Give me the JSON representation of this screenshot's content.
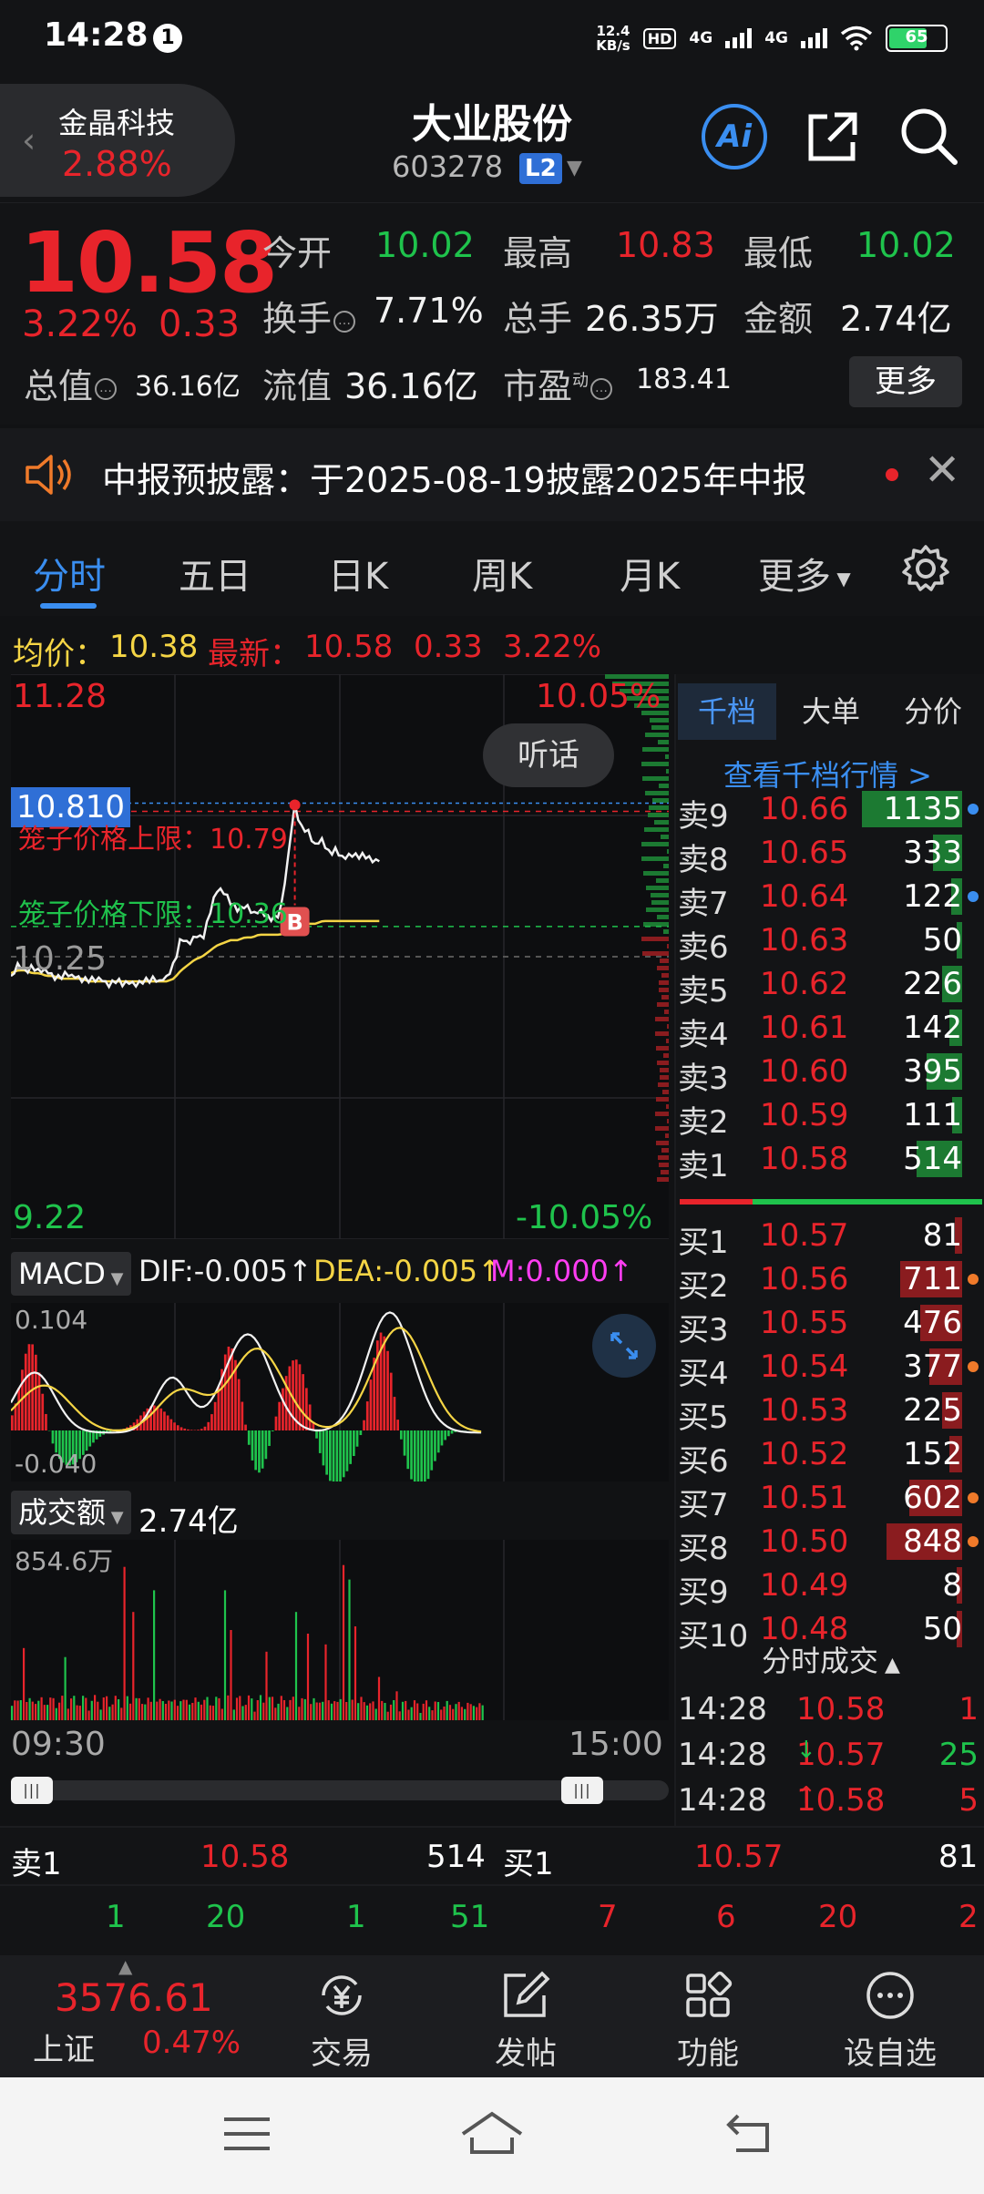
{
  "status_bar": {
    "time": "14:28",
    "notification_count": "1",
    "net_speed_value": "12.4",
    "net_speed_unit": "KB/s",
    "hd": "HD",
    "hd_sub": "1",
    "sig1": "4G",
    "sig2": "4G",
    "battery": "65"
  },
  "header": {
    "back_name": "金晶科技",
    "back_pct": "2.88%",
    "stock_name": "大业股份",
    "stock_code": "603278",
    "level": "L2",
    "ai": "Ai"
  },
  "quote": {
    "price": "10.58",
    "change_pct": "3.22%",
    "change": "0.33",
    "open_label": "今开",
    "open": "10.02",
    "high_label": "最高",
    "high": "10.83",
    "low_label": "最低",
    "low": "10.02",
    "turnover_label": "换手",
    "turnover": "7.71%",
    "volume_label": "总手",
    "volume": "26.35万",
    "amount_label": "金额",
    "amount": "2.74亿",
    "mktcap_label": "总值",
    "mktcap": "36.16亿",
    "float_label": "流值",
    "float": "36.16亿",
    "pe_label": "市盈",
    "pe_sup": "动",
    "pe": "183.41",
    "more": "更多"
  },
  "notice": {
    "text": "中报预披露：于2025-08-19披露2025年中报"
  },
  "tabs": [
    {
      "label": "分时"
    },
    {
      "label": "五日"
    },
    {
      "label": "日K"
    },
    {
      "label": "周K"
    },
    {
      "label": "月K"
    },
    {
      "label": "更多"
    }
  ],
  "avg_line": {
    "avg_label": "均价：",
    "avg": "10.38",
    "last_label": "最新：",
    "last": "10.58",
    "chg": "0.33",
    "pct": "3.22%"
  },
  "chart": {
    "top_price": "11.28",
    "top_pct": "10.05%",
    "mid_price": "10.25",
    "bottom_price": "9.22",
    "bottom_pct": "-10.05%",
    "listen": "听话",
    "flag_price": "10.810",
    "cage_high": "笼子价格上限：10.79",
    "cage_low": "笼子价格下限：10.36",
    "buy_marker": "B"
  },
  "chart_data": {
    "type": "line",
    "title": "",
    "ylim": [
      9.22,
      11.28
    ],
    "x_range": [
      "09:30",
      "15:00"
    ],
    "reference_price": 10.25,
    "price": [
      10.18,
      10.22,
      10.2,
      10.21,
      10.19,
      10.2,
      10.18,
      10.17,
      10.19,
      10.18,
      10.17,
      10.16,
      10.17,
      10.16,
      10.15,
      10.16,
      10.15,
      10.16,
      10.15,
      10.16,
      10.17,
      10.16,
      10.17,
      10.22,
      10.32,
      10.3,
      10.33,
      10.31,
      10.4,
      10.5,
      10.48,
      10.45,
      10.42,
      10.44,
      10.41,
      10.42,
      10.4,
      10.39,
      10.4,
      10.58,
      10.81,
      10.72,
      10.7,
      10.66,
      10.68,
      10.62,
      10.64,
      10.6,
      10.63,
      10.61,
      10.62,
      10.6,
      10.61
    ],
    "avg": [
      10.19,
      10.2,
      10.2,
      10.19,
      10.19,
      10.18,
      10.18,
      10.17,
      10.17,
      10.17,
      10.17,
      10.16,
      10.16,
      10.16,
      10.16,
      10.16,
      10.16,
      10.16,
      10.16,
      10.16,
      10.16,
      10.16,
      10.16,
      10.17,
      10.2,
      10.22,
      10.24,
      10.25,
      10.27,
      10.29,
      10.3,
      10.31,
      10.31,
      10.32,
      10.32,
      10.33,
      10.33,
      10.33,
      10.33,
      10.34,
      10.36,
      10.37,
      10.37,
      10.37,
      10.38,
      10.38,
      10.38,
      10.38,
      10.38,
      10.38,
      10.38,
      10.38,
      10.38
    ],
    "macd": {
      "label": "MACD",
      "dif_label": "DIF:",
      "dif": "-0.005",
      "dea_label": "DEA:",
      "dea": "-0.005",
      "m_label": "M:",
      "m": "0.000",
      "top": "0.104",
      "bottom": "-0.040"
    },
    "volume": {
      "label": "成交额",
      "total": "2.74亿",
      "max": "854.6万"
    },
    "time_start": "09:30",
    "time_end": "15:00"
  },
  "order_book": {
    "tabs": [
      "千档",
      "大单",
      "分价"
    ],
    "more_link": "查看千档行情 >",
    "asks": [
      {
        "label": "卖9",
        "price": "10.66",
        "qty": "1135",
        "bar": 1.0,
        "dot": "#3a8ef0"
      },
      {
        "label": "卖8",
        "price": "10.65",
        "qty": "333",
        "bar": 0.29,
        "dot": ""
      },
      {
        "label": "卖7",
        "price": "10.64",
        "qty": "122",
        "bar": 0.11,
        "dot": "#3a8ef0"
      },
      {
        "label": "卖6",
        "price": "10.63",
        "qty": "50",
        "bar": 0.04,
        "dot": ""
      },
      {
        "label": "卖5",
        "price": "10.62",
        "qty": "226",
        "bar": 0.2,
        "dot": ""
      },
      {
        "label": "卖4",
        "price": "10.61",
        "qty": "142",
        "bar": 0.13,
        "dot": ""
      },
      {
        "label": "卖3",
        "price": "10.60",
        "qty": "395",
        "bar": 0.35,
        "dot": ""
      },
      {
        "label": "卖2",
        "price": "10.59",
        "qty": "111",
        "bar": 0.1,
        "dot": ""
      },
      {
        "label": "卖1",
        "price": "10.58",
        "qty": "514",
        "bar": 0.45,
        "dot": ""
      }
    ],
    "bids": [
      {
        "label": "买1",
        "price": "10.57",
        "qty": "81",
        "bar": 0.07,
        "dot": ""
      },
      {
        "label": "买2",
        "price": "10.56",
        "qty": "711",
        "bar": 0.62,
        "dot": "#f07a2a"
      },
      {
        "label": "买3",
        "price": "10.55",
        "qty": "476",
        "bar": 0.42,
        "dot": ""
      },
      {
        "label": "买4",
        "price": "10.54",
        "qty": "377",
        "bar": 0.33,
        "dot": "#f07a2a"
      },
      {
        "label": "买5",
        "price": "10.53",
        "qty": "225",
        "bar": 0.2,
        "dot": ""
      },
      {
        "label": "买6",
        "price": "10.52",
        "qty": "152",
        "bar": 0.13,
        "dot": ""
      },
      {
        "label": "买7",
        "price": "10.51",
        "qty": "602",
        "bar": 0.53,
        "dot": "#f07a2a"
      },
      {
        "label": "买8",
        "price": "10.50",
        "qty": "848",
        "bar": 0.75,
        "dot": "#f07a2a"
      },
      {
        "label": "买9",
        "price": "10.49",
        "qty": "8",
        "bar": 0.01,
        "dot": ""
      },
      {
        "label": "买10",
        "price": "10.48",
        "qty": "50",
        "bar": 0.04,
        "dot": ""
      }
    ],
    "trades_title": "分时成交",
    "trades": [
      {
        "time": "14:28",
        "price": "10.58",
        "arrow": "",
        "qty": "1",
        "qty_color": "#e8242b"
      },
      {
        "time": "14:28",
        "price": "10.57",
        "arrow": "↓",
        "qty": "25",
        "qty_color": "#1fc34c"
      },
      {
        "time": "14:28",
        "price": "10.58",
        "arrow": "↑",
        "qty": "5",
        "qty_color": "#e8242b"
      }
    ]
  },
  "bottom_band": {
    "ask1_label": "卖1",
    "ask1_price": "10.58",
    "ask1_qty": "514",
    "bid1_label": "买1",
    "bid1_price": "10.57",
    "bid1_qty": "81",
    "left_nums": [
      "1",
      "20",
      "1",
      "51"
    ],
    "right_nums": [
      "7",
      "6",
      "20",
      "2"
    ]
  },
  "bottom_nav": {
    "index_value": "3576.61",
    "index_name": "上证",
    "index_pct": "0.47%",
    "items": [
      "交易",
      "发帖",
      "功能",
      "设自选"
    ]
  }
}
